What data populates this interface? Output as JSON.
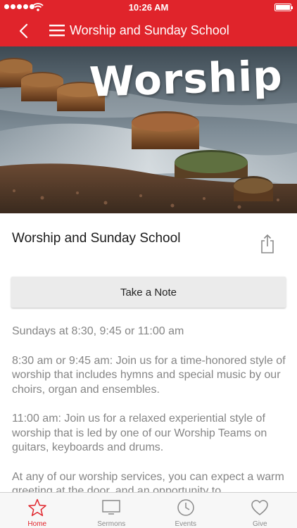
{
  "status_bar": {
    "time": "10:26 AM"
  },
  "nav": {
    "title": "Worship and Sunday School",
    "back_icon": "chevron-left-icon",
    "menu_icon": "hamburger-menu-icon"
  },
  "hero": {
    "overlay_text": "Worship"
  },
  "content": {
    "title": "Worship and Sunday School",
    "share_icon": "share-icon",
    "note_button_label": "Take a Note",
    "paragraphs": [
      "Sundays at 8:30, 9:45 or 11:00 am",
      "8:30 am or  9:45 am: Join us for a time-honored style of worship that includes hymns and special music by our choirs, organ and ensembles.",
      "11:00 am: Join us for a relaxed experiential style of worship that is led by one of our Worship Teams on guitars, keyboards and drums.",
      "At any of our worship services, you can expect a warm greeting at the door, and an opportunity to"
    ]
  },
  "tabs": [
    {
      "label": "Home",
      "icon": "star-icon",
      "active": true
    },
    {
      "label": "Sermons",
      "icon": "tv-icon",
      "active": false
    },
    {
      "label": "Events",
      "icon": "clock-icon",
      "active": false
    },
    {
      "label": "Give",
      "icon": "heart-icon",
      "active": false
    }
  ],
  "colors": {
    "brand_red": "#e0242b",
    "body_text": "#858585",
    "tab_inactive": "#8a8a8a"
  }
}
